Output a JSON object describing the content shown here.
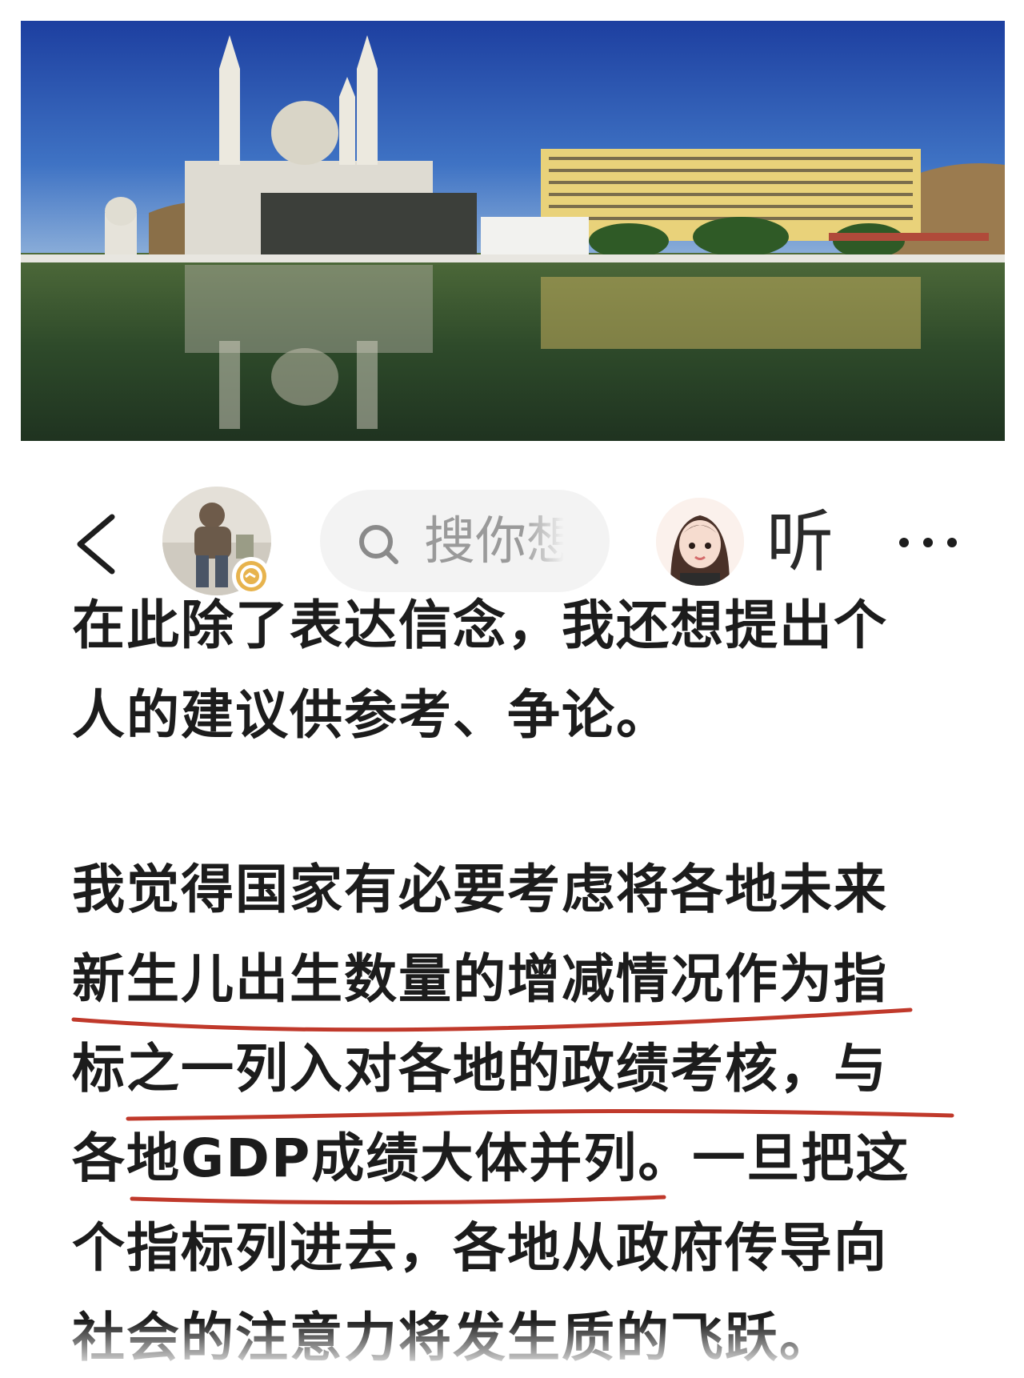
{
  "header": {
    "search_placeholder": "搜你想",
    "listen_label": "听"
  },
  "article": {
    "lines": [
      "在此除了表达信念，我还想提出个",
      "人的建议供参考、争论。",
      "我觉得国家有必要考虑将各地未来",
      "新生儿出生数量的增减情况作为指",
      "标之一列入对各地的政绩考核，与",
      "各地GDP成绩大体并列。一旦把这",
      "个指标列进去，各地从政府传导向",
      "社会的注意力将发生质的飞跃。"
    ]
  },
  "icons": {
    "back": "chevron-left-icon",
    "search": "search-icon",
    "more": "more-horizontal-icon",
    "verified": "verified-badge-icon"
  },
  "colors": {
    "underline": "#c0392b",
    "text": "#1c1c1c",
    "search_bg": "#f3f3f3"
  }
}
